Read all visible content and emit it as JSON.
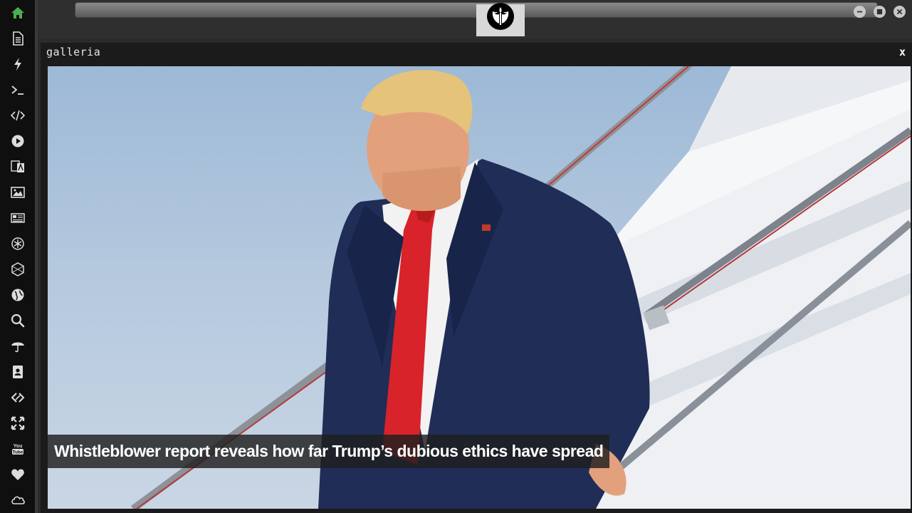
{
  "sidebar": {
    "items": [
      {
        "icon": "home-icon",
        "color": "#4caf50"
      },
      {
        "icon": "document-icon"
      },
      {
        "icon": "lightning-icon"
      },
      {
        "icon": "terminal-icon"
      },
      {
        "icon": "code-icon"
      },
      {
        "icon": "play-icon"
      },
      {
        "icon": "translate-icon"
      },
      {
        "icon": "image-icon"
      },
      {
        "icon": "newspaper-icon"
      },
      {
        "icon": "atom-icon"
      },
      {
        "icon": "hexagon-icon"
      },
      {
        "icon": "globe-icon"
      },
      {
        "icon": "search-icon"
      },
      {
        "icon": "umbrella-icon"
      },
      {
        "icon": "contacts-icon"
      },
      {
        "icon": "link-icon"
      },
      {
        "icon": "expand-icon"
      },
      {
        "icon": "youtube-icon"
      },
      {
        "icon": "heart-icon"
      },
      {
        "icon": "cloud-icon"
      }
    ]
  },
  "titlebar": {
    "logo_icon": "rebel-alliance-icon",
    "buttons": [
      "minimize-icon",
      "maximize-icon",
      "close-icon"
    ]
  },
  "panel": {
    "title": "galleria",
    "close_label": "x"
  },
  "gallery": {
    "caption": "Whistleblower report reveals how far Trump’s dubious ethics have spread"
  },
  "colors": {
    "sidebar_bg": "#0f0f0f",
    "accent_home": "#4caf50",
    "panel_bg": "#1b1b1b",
    "caption_bg": "#1e1e1e"
  }
}
